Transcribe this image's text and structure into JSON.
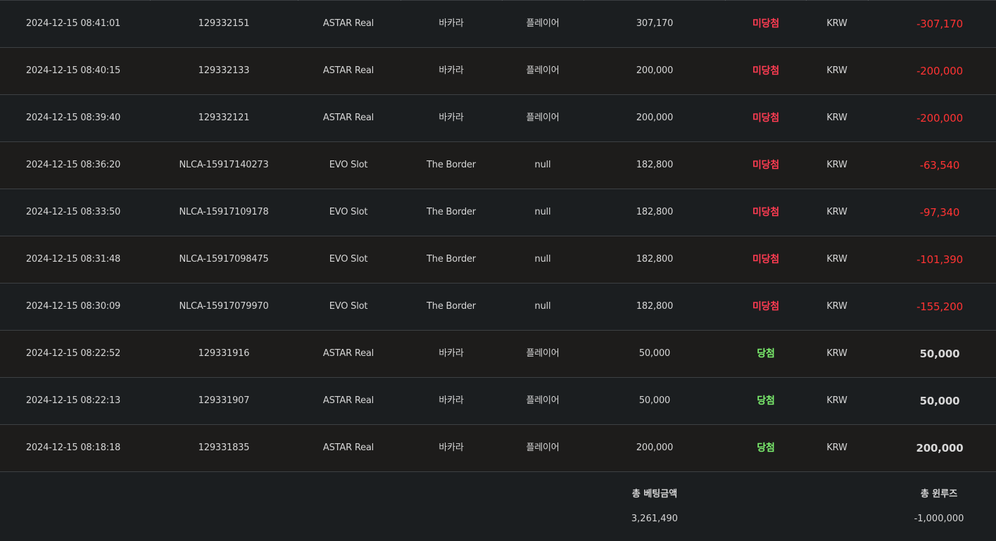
{
  "rows": [
    {
      "date": "2024-12-15 08:41:01",
      "id": "129332151",
      "provider": "ASTAR Real",
      "game": "바카라",
      "bet_type": "플레이어",
      "amount": "307,170",
      "result": "미당첨",
      "currency": "KRW",
      "winloss": "-307,170"
    },
    {
      "date": "2024-12-15 08:40:15",
      "id": "129332133",
      "provider": "ASTAR Real",
      "game": "바카라",
      "bet_type": "플레이어",
      "amount": "200,000",
      "result": "미당첨",
      "currency": "KRW",
      "winloss": "-200,000"
    },
    {
      "date": "2024-12-15 08:39:40",
      "id": "129332121",
      "provider": "ASTAR Real",
      "game": "바카라",
      "bet_type": "플레이어",
      "amount": "200,000",
      "result": "미당첨",
      "currency": "KRW",
      "winloss": "-200,000"
    },
    {
      "date": "2024-12-15 08:36:20",
      "id": "NLCA-15917140273",
      "provider": "EVO Slot",
      "game": "The Border",
      "bet_type": "null",
      "amount": "182,800",
      "result": "미당첨",
      "currency": "KRW",
      "winloss": "-63,540"
    },
    {
      "date": "2024-12-15 08:33:50",
      "id": "NLCA-15917109178",
      "provider": "EVO Slot",
      "game": "The Border",
      "bet_type": "null",
      "amount": "182,800",
      "result": "미당첨",
      "currency": "KRW",
      "winloss": "-97,340"
    },
    {
      "date": "2024-12-15 08:31:48",
      "id": "NLCA-15917098475",
      "provider": "EVO Slot",
      "game": "The Border",
      "bet_type": "null",
      "amount": "182,800",
      "result": "미당첨",
      "currency": "KRW",
      "winloss": "-101,390"
    },
    {
      "date": "2024-12-15 08:30:09",
      "id": "NLCA-15917079970",
      "provider": "EVO Slot",
      "game": "The Border",
      "bet_type": "null",
      "amount": "182,800",
      "result": "미당첨",
      "currency": "KRW",
      "winloss": "-155,200"
    },
    {
      "date": "2024-12-15 08:22:52",
      "id": "129331916",
      "provider": "ASTAR Real",
      "game": "바카라",
      "bet_type": "플레이어",
      "amount": "50,000",
      "result": "당첨",
      "currency": "KRW",
      "winloss": "50,000"
    },
    {
      "date": "2024-12-15 08:22:13",
      "id": "129331907",
      "provider": "ASTAR Real",
      "game": "바카라",
      "bet_type": "플레이어",
      "amount": "50,000",
      "result": "당첨",
      "currency": "KRW",
      "winloss": "50,000"
    },
    {
      "date": "2024-12-15 08:18:18",
      "id": "129331835",
      "provider": "ASTAR Real",
      "game": "바카라",
      "bet_type": "플레이어",
      "amount": "200,000",
      "result": "당첨",
      "currency": "KRW",
      "winloss": "200,000"
    }
  ],
  "summary": {
    "total_bet_label": "총 베팅금액",
    "total_bet_value": "3,261,490",
    "total_winloss_label": "총 윈루즈",
    "total_winloss_value": "-1,000,000"
  },
  "colors": {
    "lose": "#ff3c52",
    "win": "#7cf06e",
    "negative_amount": "#ff3333"
  }
}
